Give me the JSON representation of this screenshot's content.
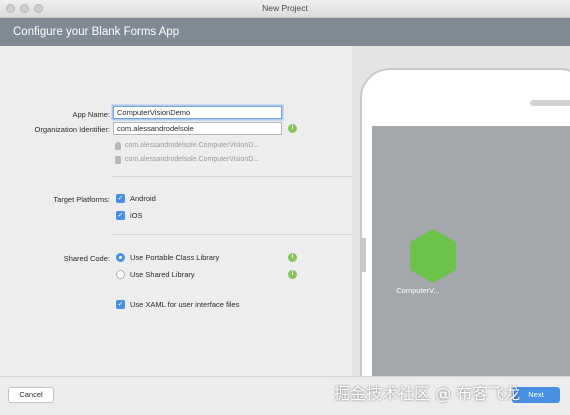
{
  "window": {
    "title": "New Project"
  },
  "header": {
    "title": "Configure your Blank Forms App"
  },
  "form": {
    "app_name": {
      "label": "App Name:",
      "value": "ComputerVisionDemo"
    },
    "org_id": {
      "label": "Organization Identifier:",
      "value": "com.alessandrodelsole"
    },
    "android_package": "com.alessandrodelsole.ComputerVisionD...",
    "ios_bundle": "com.alessandrodelsole.ComputerVisionD...",
    "target_platforms": {
      "label": "Target Platforms:",
      "options": [
        {
          "label": "Android",
          "checked": true
        },
        {
          "label": "iOS",
          "checked": true
        }
      ]
    },
    "shared_code": {
      "label": "Shared Code:",
      "options": [
        {
          "label": "Use Portable Class Library",
          "selected": true
        },
        {
          "label": "Use Shared Library",
          "selected": false
        }
      ]
    },
    "use_xaml": {
      "label": "Use XAML for user interface files",
      "checked": true
    }
  },
  "preview": {
    "app_label": "ComputerV...",
    "icon_color": "#6cc24a"
  },
  "footer": {
    "cancel_label": "Cancel",
    "next_label": "Next"
  },
  "watermark": "掘金技术社区 @ 布客飞龙",
  "colors": {
    "header": "#7f8a95",
    "accent": "#4a90e2",
    "info": "#86c45e"
  }
}
